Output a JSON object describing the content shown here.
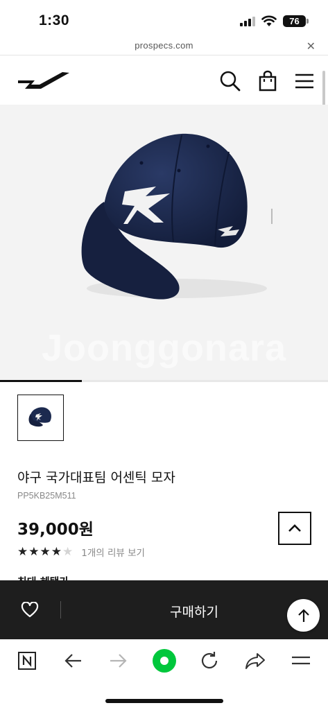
{
  "status_bar": {
    "time": "1:30",
    "battery": "76",
    "icons": [
      "signal-icon",
      "wifi-icon",
      "battery-icon"
    ]
  },
  "url_bar": {
    "url": "prospecs.com",
    "close_icon": "close-icon"
  },
  "header": {
    "icons": [
      "prospecs-logo",
      "search-icon",
      "shopping-bag-icon",
      "hamburger-menu-icon"
    ]
  },
  "product": {
    "watermark": "Joonggonara",
    "image_index": 1,
    "image_count": 4,
    "name": "야구 국가대표팀 어센틱 모자",
    "code": "PP5KB25M511",
    "price": "39,000원",
    "rating": 4,
    "rating_max": 5,
    "review_link": "1개의 리뷰 보기",
    "cutoff_text": "최대 혜택가"
  },
  "purchase_bar": {
    "buy_label": "구매하기",
    "icons": [
      "heart-icon",
      "arrow-up-icon"
    ]
  },
  "browser_toolbar": {
    "icons": [
      "naver-n-icon",
      "back-arrow-icon",
      "forward-arrow-icon",
      "green-dot-icon",
      "reload-icon",
      "share-icon",
      "menu-icon"
    ]
  },
  "colors": {
    "purchase_bar_bg": "#1e1e1e",
    "cap_navy": "#1c2a4f",
    "green_button": "#00c73c"
  }
}
